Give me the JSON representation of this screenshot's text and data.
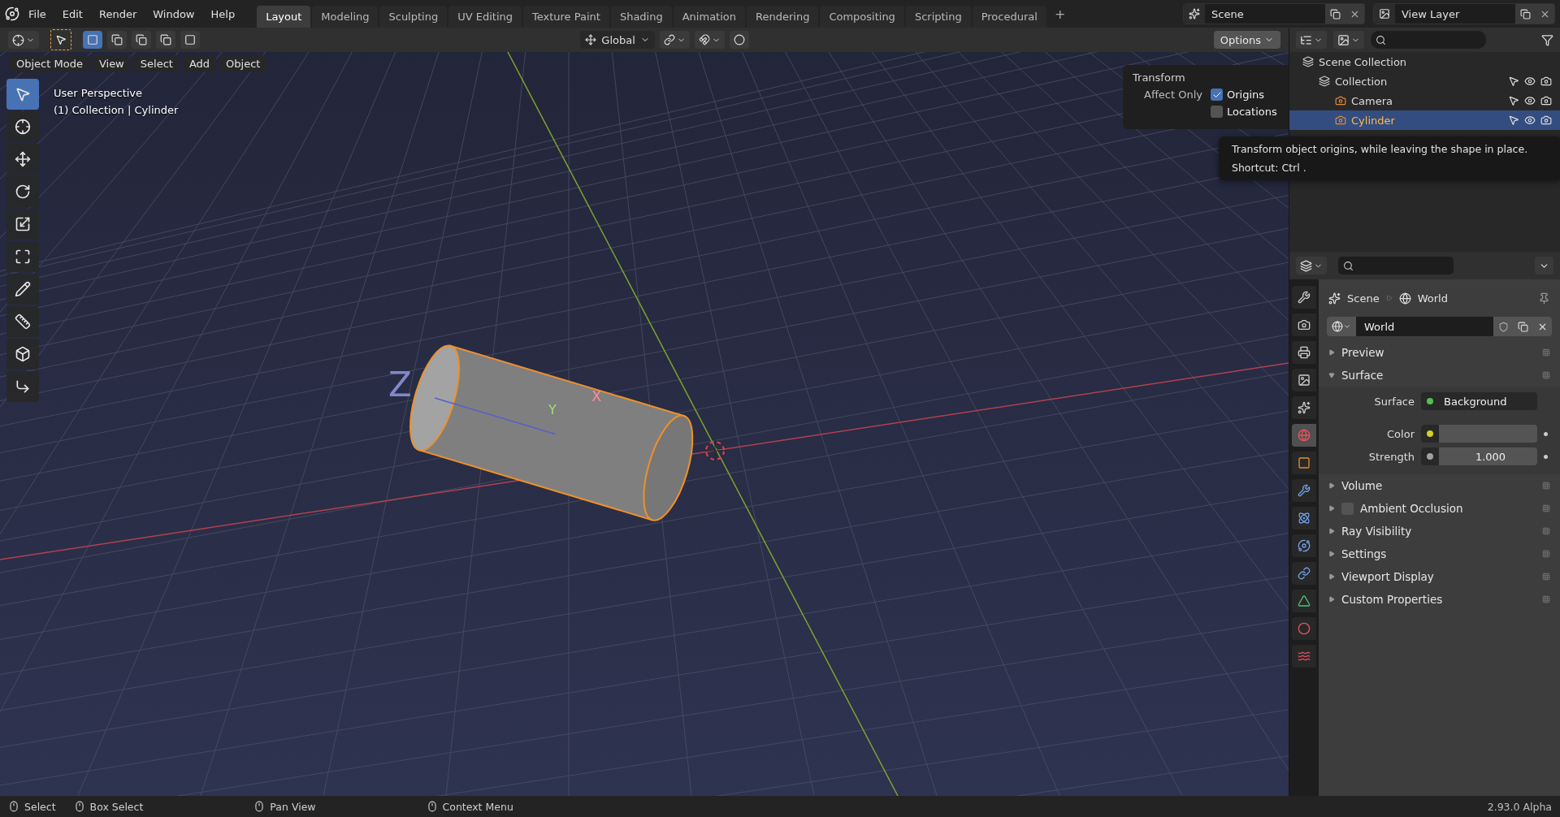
{
  "menu": [
    {
      "label": "File"
    },
    {
      "label": "Edit"
    },
    {
      "label": "Render"
    },
    {
      "label": "Window"
    },
    {
      "label": "Help"
    }
  ],
  "workspaces": [
    {
      "label": "Layout",
      "selected": true
    },
    {
      "label": "Modeling",
      "selected": false
    },
    {
      "label": "Sculpting",
      "selected": false
    },
    {
      "label": "UV Editing",
      "selected": false
    },
    {
      "label": "Texture Paint",
      "selected": false
    },
    {
      "label": "Shading",
      "selected": false
    },
    {
      "label": "Animation",
      "selected": false
    },
    {
      "label": "Rendering",
      "selected": false
    },
    {
      "label": "Compositing",
      "selected": false
    },
    {
      "label": "Scripting",
      "selected": false
    },
    {
      "label": "Procedural",
      "selected": false
    }
  ],
  "add_workspace": "+",
  "scene": "Scene",
  "view_layer": "View Layer",
  "tool_header": {
    "orientation": "Global",
    "options": "Options"
  },
  "viewport": {
    "mode": "Object Mode",
    "menus": [
      "View",
      "Select",
      "Add",
      "Object"
    ],
    "overlay_lines": [
      "User Perspective",
      "(1) Collection | Cylinder"
    ],
    "axis_letters": [
      "Z",
      "Y",
      "X"
    ]
  },
  "tools": [
    {
      "kind": "select",
      "selected": true
    },
    {
      "kind": "cursor",
      "selected": false
    },
    {
      "kind": "move",
      "selected": false
    },
    {
      "kind": "rotate",
      "selected": false
    },
    {
      "kind": "scale",
      "selected": false
    },
    {
      "kind": "transform",
      "selected": false
    },
    {
      "kind": "annotate",
      "selected": false
    },
    {
      "kind": "measure",
      "selected": false
    },
    {
      "kind": "add-cube",
      "selected": false
    },
    {
      "kind": "corner",
      "selected": false
    }
  ],
  "popover": {
    "title": "Transform",
    "label": "Affect Only",
    "options": [
      {
        "label": "Origins",
        "checked": true
      },
      {
        "label": "Locations",
        "checked": false
      }
    ]
  },
  "tooltip": {
    "text": "Transform object origins, while leaving the shape in place.",
    "shortcut": "Shortcut: Ctrl ."
  },
  "outliner": {
    "items": [
      {
        "label": "Scene Collection",
        "selected": false,
        "children": [
          {
            "label": "Collection",
            "selected": false,
            "children": [
              {
                "label": "Camera",
                "selected": false
              },
              {
                "label": "Cylinder",
                "selected": true
              }
            ]
          }
        ]
      }
    ]
  },
  "properties": {
    "tabs": [
      {
        "kind": "tool",
        "selected": false
      },
      {
        "kind": "render",
        "selected": false
      },
      {
        "kind": "output",
        "selected": false
      },
      {
        "kind": "view-layer",
        "selected": false
      },
      {
        "kind": "scene",
        "selected": false
      },
      {
        "kind": "world",
        "selected": true
      },
      {
        "kind": "object",
        "selected": false
      },
      {
        "kind": "modifiers",
        "selected": false
      },
      {
        "kind": "particles",
        "selected": false
      },
      {
        "kind": "physics",
        "selected": false
      },
      {
        "kind": "constraints",
        "selected": false
      },
      {
        "kind": "data",
        "selected": false
      },
      {
        "kind": "material",
        "selected": false
      },
      {
        "kind": "texture",
        "selected": false
      }
    ],
    "breadcrumb": [
      "Scene",
      "World"
    ],
    "datablock": "World",
    "panels": [
      {
        "kind": "panel",
        "label": "Preview",
        "expanded": false
      },
      {
        "kind": "panel",
        "label": "Surface",
        "expanded": true,
        "fields": [
          {
            "label": "Surface",
            "value": "Background",
            "color": "#4fc24f",
            "kind": "shader"
          },
          {
            "label": "Color",
            "color": "#d4cf22",
            "kind": "color"
          },
          {
            "label": "Strength",
            "value": "1.000",
            "color": "#a0a0a0",
            "kind": "number"
          }
        ]
      },
      {
        "kind": "panel",
        "label": "Volume",
        "expanded": false
      },
      {
        "kind": "toggle",
        "label": "Ambient Occlusion",
        "expanded": false,
        "checked": false
      },
      {
        "kind": "panel",
        "label": "Ray Visibility",
        "expanded": false
      },
      {
        "kind": "panel",
        "label": "Settings",
        "expanded": false
      },
      {
        "kind": "panel",
        "label": "Viewport Display",
        "expanded": false
      },
      {
        "kind": "panel",
        "label": "Custom Properties",
        "expanded": false
      }
    ]
  },
  "status_bar": {
    "hints": [
      "Select",
      "Box Select",
      "Pan View",
      "Context Menu"
    ],
    "version": "2.93.0 Alpha"
  }
}
